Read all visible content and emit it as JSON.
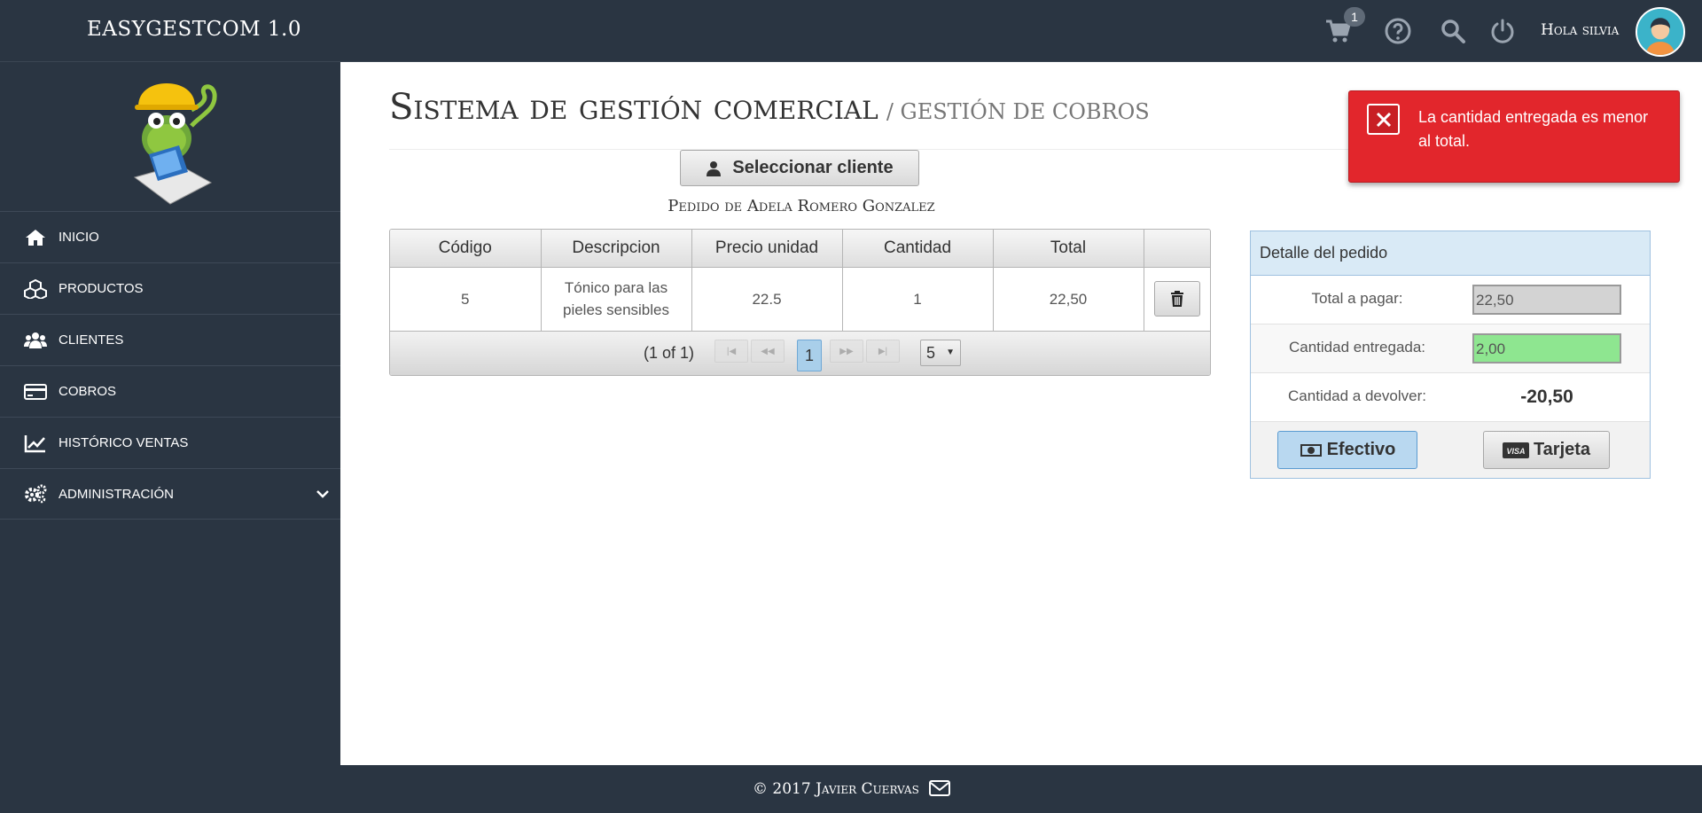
{
  "topbar": {
    "app_title": "EASYGESTCOM 1.0",
    "cart_count": "1",
    "greeting": "Hola silvia",
    "icons": [
      "cart-icon",
      "help-icon",
      "search-icon",
      "power-icon"
    ]
  },
  "sidebar": {
    "items": [
      {
        "label": "INICIO",
        "icon": "home-icon"
      },
      {
        "label": "PRODUCTOS",
        "icon": "cubes-icon"
      },
      {
        "label": "CLIENTES",
        "icon": "users-icon"
      },
      {
        "label": "COBROS",
        "icon": "credit-card-icon"
      },
      {
        "label": "HISTÓRICO VENTAS",
        "icon": "line-chart-icon"
      },
      {
        "label": "ADMINISTRACIÓN",
        "icon": "gears-icon"
      }
    ]
  },
  "page": {
    "title": "Sistema de gestión comercial",
    "subtitle": "/ GESTIÓN DE COBROS"
  },
  "select_client_label": "Seleccionar cliente",
  "order_of": "Pedido de Adela Romero Gonzalez",
  "table": {
    "columns": [
      "Código",
      "Descripcion",
      "Precio unidad",
      "Cantidad",
      "Total",
      ""
    ],
    "rows": [
      {
        "codigo": "5",
        "descripcion": "Tónico para las pieles sensibles",
        "precio": "22.5",
        "cantidad": "1",
        "total": "22,50"
      }
    ],
    "paginator": {
      "report": "(1 of 1)",
      "current_page": "1",
      "rows_per_page": "5"
    }
  },
  "detail": {
    "header": "Detalle del pedido",
    "total_label": "Total a pagar:",
    "total_value": "22,50",
    "entregada_label": "Cantidad entregada:",
    "entregada_value": "2,00",
    "devolver_label": "Cantidad a devolver:",
    "devolver_value": "-20,50",
    "efectivo_label": "Efectivo",
    "tarjeta_label": "Tarjeta",
    "tarjeta_icon_text": "VISA"
  },
  "toast": {
    "message": "La cantidad entregada es menor al total.",
    "color": "#e2262c"
  },
  "footer": {
    "text": "© 2017 Javier Cuervas"
  },
  "colors": {
    "chrome": "#2a3542",
    "active_button": "#b9d8f0",
    "entregada_field": "#8ee690",
    "detail_header": "#d9eaf6"
  }
}
